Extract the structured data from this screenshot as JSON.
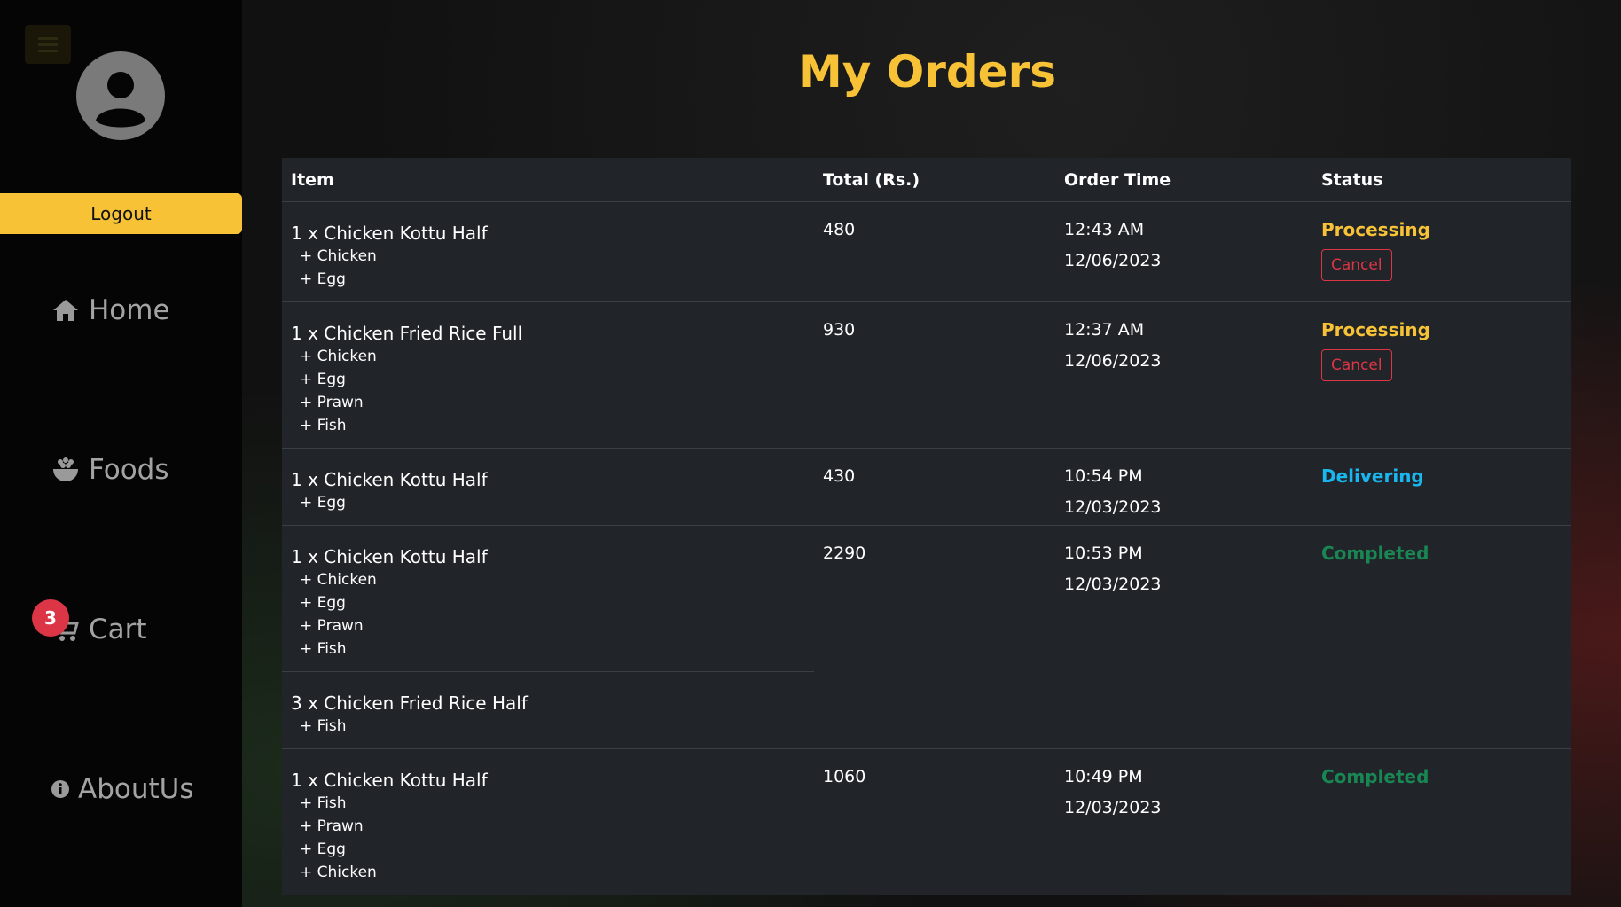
{
  "sidebar": {
    "logout_label": "Logout",
    "nav": [
      {
        "label": "Home",
        "icon": "home-icon"
      },
      {
        "label": "Foods",
        "icon": "food-bowl-icon"
      },
      {
        "label": "Cart",
        "icon": "cart-icon"
      },
      {
        "label": "AboutUs",
        "icon": "info-icon"
      }
    ],
    "cart_count": "3"
  },
  "page": {
    "title": "My Orders"
  },
  "table": {
    "headers": {
      "item": "Item",
      "total": "Total (Rs.)",
      "time": "Order Time",
      "status": "Status"
    },
    "cancel_label": "Cancel",
    "orders": [
      {
        "items": [
          {
            "name": "1 x Chicken Kottu Half",
            "addons": [
              "+ Chicken",
              "+ Egg"
            ]
          }
        ],
        "total": "480",
        "time": "12:43 AM",
        "date": "12/06/2023",
        "status": "Processing",
        "cancellable": true
      },
      {
        "items": [
          {
            "name": "1 x Chicken Fried Rice Full",
            "addons": [
              "+ Chicken",
              "+ Egg",
              "+ Prawn",
              "+ Fish"
            ]
          }
        ],
        "total": "930",
        "time": "12:37 AM",
        "date": "12/06/2023",
        "status": "Processing",
        "cancellable": true
      },
      {
        "items": [
          {
            "name": "1 x Chicken Kottu Half",
            "addons": [
              "+ Egg"
            ]
          }
        ],
        "total": "430",
        "time": "10:54 PM",
        "date": "12/03/2023",
        "status": "Delivering",
        "cancellable": false
      },
      {
        "items": [
          {
            "name": "1 x Chicken Kottu Half",
            "addons": [
              "+ Chicken",
              "+ Egg",
              "+ Prawn",
              "+ Fish"
            ]
          },
          {
            "name": "3 x Chicken Fried Rice Half",
            "addons": [
              "+ Fish"
            ]
          }
        ],
        "total": "2290",
        "time": "10:53 PM",
        "date": "12/03/2023",
        "status": "Completed",
        "cancellable": false
      },
      {
        "items": [
          {
            "name": "1 x Chicken Kottu Half",
            "addons": [
              "+ Fish",
              "+ Prawn",
              "+ Egg",
              "+ Chicken"
            ]
          }
        ],
        "total": "1060",
        "time": "10:49 PM",
        "date": "12/03/2023",
        "status": "Completed",
        "cancellable": false
      }
    ]
  },
  "colors": {
    "accent": "#f7c236",
    "processing": "#f7c236",
    "delivering": "#1ab6f0",
    "completed": "#198754",
    "cancel": "#dc3545",
    "badge": "#dc3545"
  }
}
